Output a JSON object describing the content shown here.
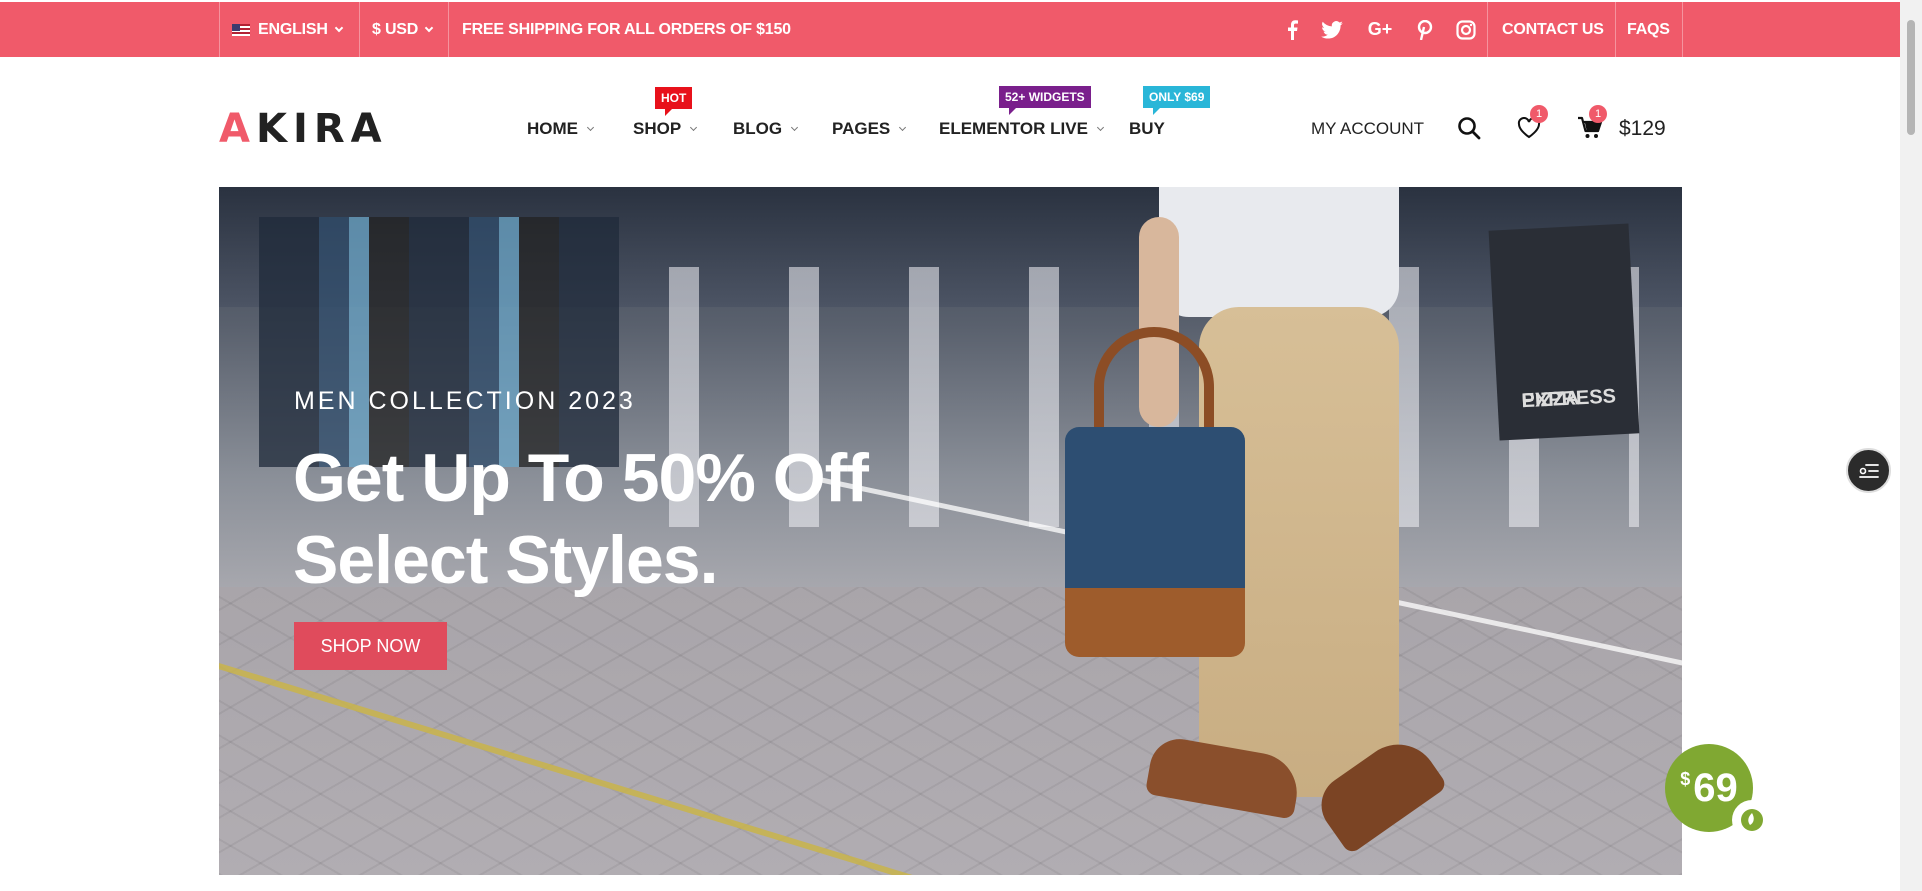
{
  "topbar": {
    "language": "ENGLISH",
    "currency": "$ USD",
    "shipping_notice": "FREE SHIPPING FOR ALL ORDERS OF $150",
    "social": [
      "facebook-icon",
      "twitter-icon",
      "google-plus-icon",
      "pinterest-icon",
      "instagram-icon"
    ],
    "contact": "CONTACT US",
    "faqs": "FAQS",
    "bg_color": "#f05a6a"
  },
  "header": {
    "logo_first": "A",
    "logo_rest": "KIRA",
    "nav": [
      {
        "label": "HOME"
      },
      {
        "label": "SHOP",
        "badge": "HOT",
        "badge_color": "#e8111b"
      },
      {
        "label": "BLOG"
      },
      {
        "label": "PAGES"
      },
      {
        "label": "ELEMENTOR LIVE",
        "badge": "52+ WIDGETS",
        "badge_color": "#7a1f8c"
      },
      {
        "label": "BUY",
        "badge": "ONLY $69",
        "badge_color": "#29b6d8"
      }
    ],
    "account": "MY ACCOUNT",
    "wishlist_count": "1",
    "cart_count": "1",
    "cart_total": "$129"
  },
  "hero": {
    "subtitle": "MEN COLLECTION 2023",
    "headline_line1": "Get Up To 50% Off",
    "headline_line2": "Select Styles.",
    "cta": "SHOP NOW",
    "sign_text_1": "PIZZA",
    "sign_text_2": "EXPRESS"
  },
  "floating": {
    "price_currency": "$",
    "price_value": "69",
    "price_color": "#80a832"
  }
}
